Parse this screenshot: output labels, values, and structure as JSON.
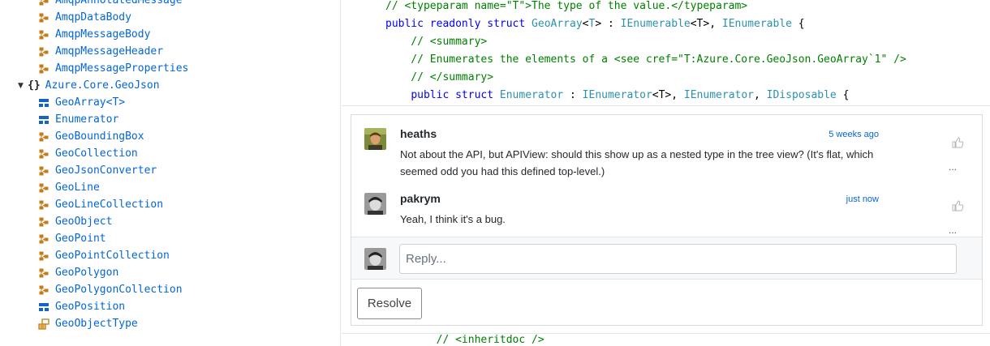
{
  "sidebar": {
    "items_top": [
      {
        "label": "AmqpAnnotatedMessage",
        "icon": "class-icon"
      },
      {
        "label": "AmqpDataBody",
        "icon": "class-icon"
      },
      {
        "label": "AmqpMessageBody",
        "icon": "class-icon"
      },
      {
        "label": "AmqpMessageHeader",
        "icon": "class-icon"
      },
      {
        "label": "AmqpMessageProperties",
        "icon": "class-icon"
      }
    ],
    "namespace": {
      "label": "Azure.Core.GeoJson",
      "icon": "namespace-icon"
    },
    "items": [
      {
        "label": "GeoArray<T>",
        "icon": "struct-icon"
      },
      {
        "label": "Enumerator",
        "icon": "struct-icon"
      },
      {
        "label": "GeoBoundingBox",
        "icon": "class-icon"
      },
      {
        "label": "GeoCollection",
        "icon": "class-icon"
      },
      {
        "label": "GeoJsonConverter",
        "icon": "class-icon"
      },
      {
        "label": "GeoLine",
        "icon": "class-icon"
      },
      {
        "label": "GeoLineCollection",
        "icon": "class-icon"
      },
      {
        "label": "GeoObject",
        "icon": "class-icon"
      },
      {
        "label": "GeoPoint",
        "icon": "class-icon"
      },
      {
        "label": "GeoPointCollection",
        "icon": "class-icon"
      },
      {
        "label": "GeoPolygon",
        "icon": "class-icon"
      },
      {
        "label": "GeoPolygonCollection",
        "icon": "class-icon"
      },
      {
        "label": "GeoPosition",
        "icon": "struct-icon"
      },
      {
        "label": "GeoObjectType",
        "icon": "enum-icon"
      }
    ]
  },
  "code": {
    "lines": [
      [
        {
          "t": "// <typeparam name=\"T\">The type of the value.</typeparam>",
          "c": "comment"
        }
      ],
      [
        {
          "t": "public",
          "c": "kw"
        },
        {
          "t": " ",
          "c": "plain"
        },
        {
          "t": "readonly",
          "c": "kw"
        },
        {
          "t": " ",
          "c": "plain"
        },
        {
          "t": "struct",
          "c": "kw"
        },
        {
          "t": " ",
          "c": "plain"
        },
        {
          "t": "GeoArray",
          "c": "type"
        },
        {
          "t": "<",
          "c": "plain"
        },
        {
          "t": "T",
          "c": "type"
        },
        {
          "t": "> : ",
          "c": "plain"
        },
        {
          "t": "IEnumerable",
          "c": "type"
        },
        {
          "t": "<T>, ",
          "c": "plain"
        },
        {
          "t": "IEnumerable",
          "c": "type"
        },
        {
          "t": " {",
          "c": "plain"
        }
      ],
      [
        {
          "t": "    // <summary>",
          "c": "comment"
        }
      ],
      [
        {
          "t": "    // Enumerates the elements of a <see cref=\"T:Azure.Core.GeoJson.GeoArray`1\" />",
          "c": "comment"
        }
      ],
      [
        {
          "t": "    // </summary>",
          "c": "comment"
        }
      ],
      [
        {
          "t": "    ",
          "c": "plain"
        },
        {
          "t": "public",
          "c": "kw"
        },
        {
          "t": " ",
          "c": "plain"
        },
        {
          "t": "struct",
          "c": "kw"
        },
        {
          "t": " ",
          "c": "plain"
        },
        {
          "t": "Enumerator",
          "c": "type"
        },
        {
          "t": " : ",
          "c": "plain"
        },
        {
          "t": "IEnumerator",
          "c": "type"
        },
        {
          "t": "<T>, ",
          "c": "plain"
        },
        {
          "t": "IEnumerator",
          "c": "type"
        },
        {
          "t": ", ",
          "c": "plain"
        },
        {
          "t": "IDisposable",
          "c": "type"
        },
        {
          "t": " {",
          "c": "plain"
        }
      ]
    ],
    "bottom_line": "        // <inheritdoc />"
  },
  "thread": {
    "comments": [
      {
        "author": "heaths",
        "time": "5 weeks ago",
        "body": "Not about the API, but APIView: should this show up as a nested type in the tree view? (It's flat, which seemed odd you had this defined top-level.)",
        "more": "..."
      },
      {
        "author": "pakrym",
        "time": "just now",
        "body": "Yeah, I think it's a bug.",
        "more": "..."
      }
    ],
    "reply_placeholder": "Reply...",
    "resolve_label": "Resolve"
  },
  "colors": {
    "link": "#0366d6",
    "class_icon": "#c27d1a",
    "struct_icon": "#1565c0",
    "comment": "#008000",
    "keyword": "#0000ff",
    "type": "#2b91af"
  }
}
